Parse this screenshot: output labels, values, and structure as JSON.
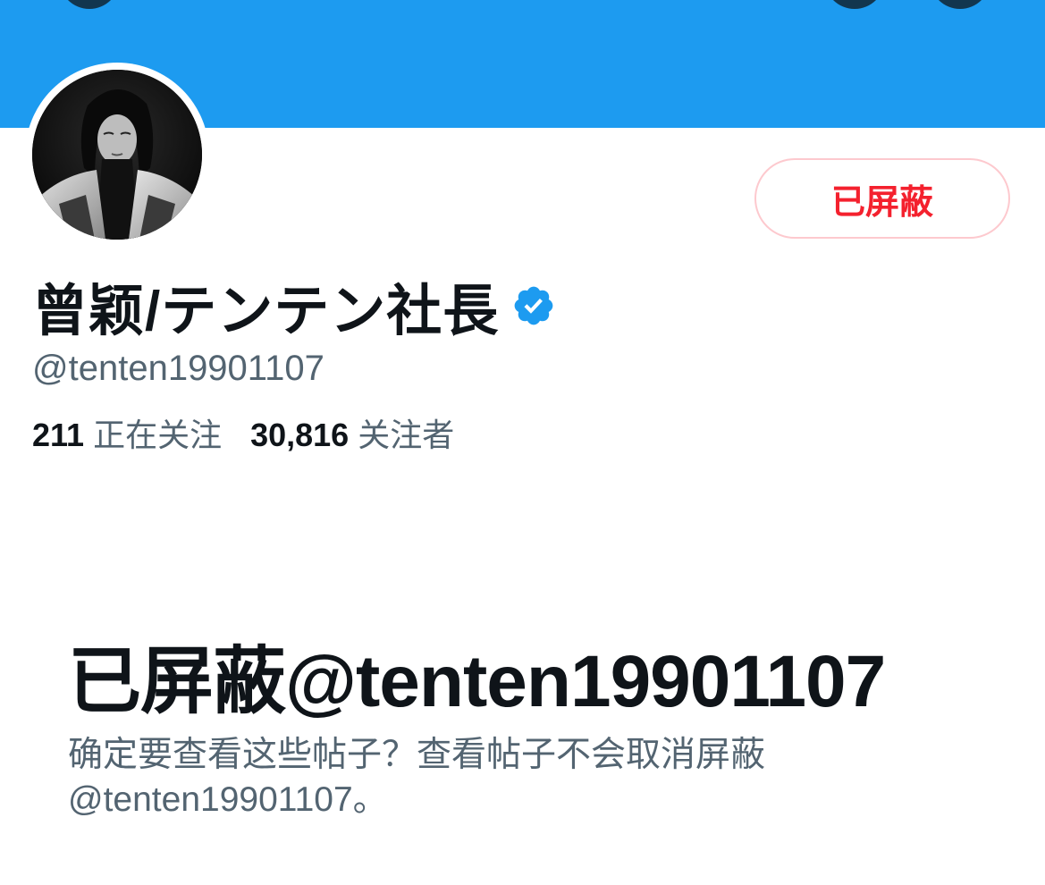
{
  "profile": {
    "display_name": "曾颖/テンテン社長",
    "handle": "@tenten19901107",
    "following_count": "211",
    "following_label": "正在关注",
    "followers_count": "30,816",
    "followers_label": "关注者",
    "verified": true,
    "avatar_description": "black-and-white portrait photo"
  },
  "actions": {
    "blocked_button_label": "已屏蔽"
  },
  "blocked_notice": {
    "title": "已屏蔽@tenten19901107",
    "description": "确定要查看这些帖子？查看帖子不会取消屏蔽 @tenten19901107。"
  },
  "icons": {
    "verified": "verified-badge-icon",
    "back": "back-arrow-icon",
    "search": "search-icon",
    "more": "more-icon"
  },
  "colors": {
    "banner": "#1d9bf0",
    "verified": "#1d9bf0",
    "blocked_red": "#f4212e",
    "blocked_border": "#fdc9ce",
    "primary_text": "#0f1419",
    "secondary_text": "#536471"
  }
}
